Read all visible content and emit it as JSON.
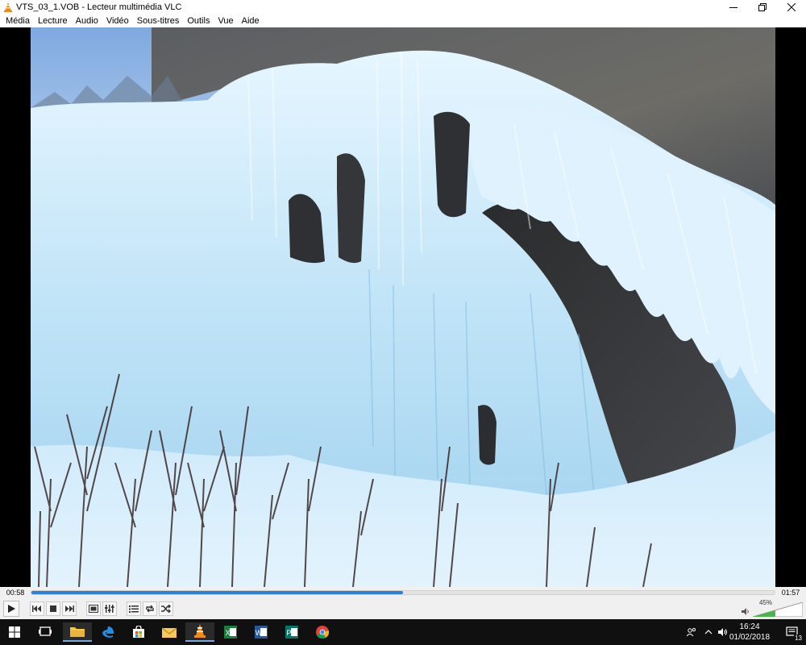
{
  "window": {
    "title": "VTS_03_1.VOB - Lecteur multimédia VLC",
    "controls": [
      "minimize",
      "restore",
      "close"
    ]
  },
  "menu": {
    "items": [
      "Média",
      "Lecture",
      "Audio",
      "Vidéo",
      "Sous-titres",
      "Outils",
      "Vue",
      "Aide"
    ]
  },
  "player": {
    "elapsed": "00:58",
    "total": "01:57",
    "progress": 0.5,
    "volume_label": "45%",
    "volume": 0.45
  },
  "controls": {
    "buttons": [
      "play",
      "previous",
      "stop",
      "next",
      "fullscreen",
      "extended-settings",
      "playlist",
      "loop",
      "random"
    ]
  },
  "taskbar": {
    "apps": [
      "task-view",
      "file-explorer",
      "edge",
      "store",
      "mail-folder",
      "vlc",
      "excel",
      "word",
      "publisher",
      "chrome"
    ],
    "time": "16:24",
    "date": "01/02/2018",
    "notification_count": "13"
  },
  "colors": {
    "accent": "#2f7fd6",
    "vlc_orange": "#f28a17",
    "volume_green": "#47b54a"
  }
}
